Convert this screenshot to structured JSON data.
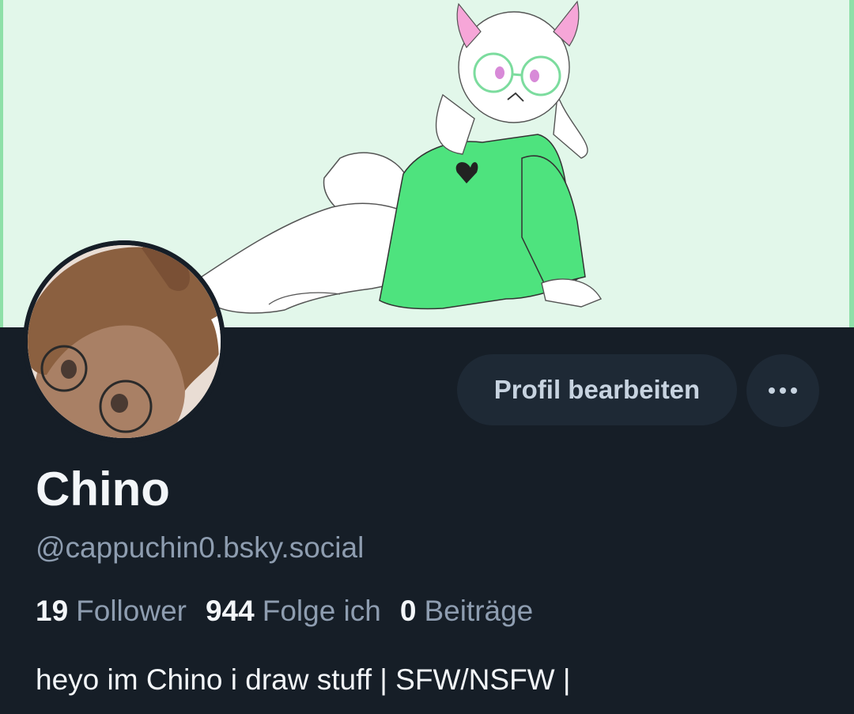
{
  "profile": {
    "display_name": "Chino",
    "handle": "@cappuchin0.bsky.social",
    "bio": "heyo im Chino i draw stuff | SFW/NSFW |",
    "stats": {
      "followers_count": "19",
      "followers_label": "Follower",
      "following_count": "944",
      "following_label": "Folge ich",
      "posts_count": "0",
      "posts_label": "Beiträge"
    }
  },
  "actions": {
    "edit_label": "Profil bearbeiten",
    "more_icon": "ellipsis-icon"
  },
  "colors": {
    "background": "#161e27",
    "banner_background": "#e2f7ea",
    "button_background": "#1e2935",
    "primary_text": "#f3f6f9",
    "secondary_text": "#8e9db0"
  }
}
